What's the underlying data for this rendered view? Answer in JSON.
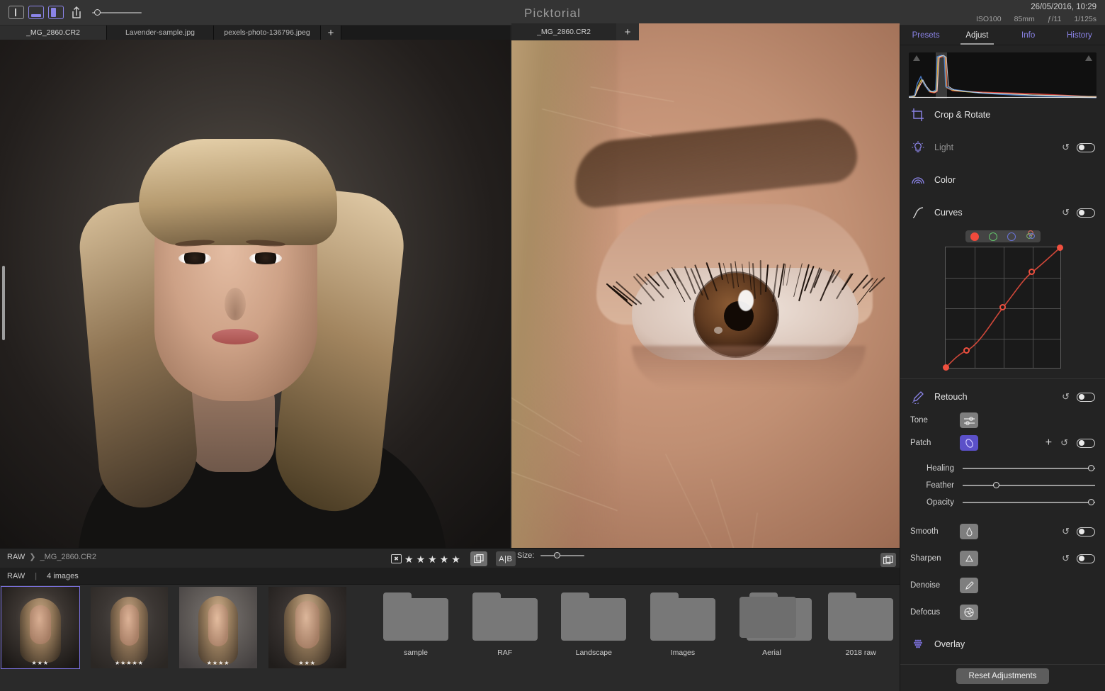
{
  "app": {
    "title": "Picktorial"
  },
  "topbar": {
    "view_modes": [
      {
        "name": "single-view",
        "selected": false
      },
      {
        "name": "split-horizontal-view",
        "selected": true
      },
      {
        "name": "split-vertical-view",
        "selected": true
      }
    ],
    "share_icon": "share-icon",
    "zoom_value": 12,
    "metadata": {
      "datetime": "26/05/2016, 10:29",
      "iso": "ISO100",
      "focal": "85mm",
      "aperture": "ƒ/11",
      "shutter": "1/125s"
    }
  },
  "tabs": {
    "items": [
      {
        "label": "_MG_2860.CR2",
        "active": true
      },
      {
        "label": "Lavender-sample.jpg",
        "active": false
      },
      {
        "label": "pexels-photo-136796.jpeg",
        "active": false
      }
    ],
    "add_label": "+"
  },
  "right_pane": {
    "tab_label": "_MG_2860.CR2",
    "add_label": "+",
    "size_label": "Size:",
    "size_value": 35,
    "fit_icon": "fit-to-screen-icon"
  },
  "bottom_toolbar": {
    "breadcrumb_root": "RAW",
    "breadcrumb_sep": "❯",
    "breadcrumb_file": "_MG_2860.CR2",
    "flag_icon": "reject-flag-icon",
    "stars": 5,
    "star_glyph": "★",
    "compare_icon": "compare-icon",
    "ab_label": "A|B"
  },
  "filmstrip": {
    "header": {
      "source": "RAW",
      "divider": "|",
      "count": "4 images"
    },
    "thumbs": [
      {
        "name": "thumb-1",
        "rating": 3,
        "selected": true
      },
      {
        "name": "thumb-2",
        "rating": 5,
        "selected": false
      },
      {
        "name": "thumb-3",
        "rating": 4,
        "selected": false
      },
      {
        "name": "thumb-4",
        "rating": 3,
        "selected": false
      }
    ],
    "folders": [
      {
        "label": "sample",
        "stacked": false
      },
      {
        "label": "RAF",
        "stacked": false
      },
      {
        "label": "Landscape",
        "stacked": false
      },
      {
        "label": "Images",
        "stacked": false
      },
      {
        "label": "Aerial",
        "stacked": true
      },
      {
        "label": "2018 raw",
        "stacked": false
      }
    ]
  },
  "panel": {
    "tabs": [
      {
        "label": "Presets",
        "active": false
      },
      {
        "label": "Adjust",
        "active": true
      },
      {
        "label": "Info",
        "active": false
      },
      {
        "label": "History",
        "active": false
      }
    ],
    "sections": {
      "crop": {
        "label": "Crop & Rotate",
        "icon": "crop-rotate-icon"
      },
      "light": {
        "label": "Light",
        "icon": "light-bulb-icon",
        "dim": true,
        "reset": "↺",
        "enabled": true
      },
      "color": {
        "label": "Color",
        "icon": "color-rainbow-icon"
      },
      "curves": {
        "label": "Curves",
        "icon": "curves-icon",
        "reset": "↺",
        "enabled": true
      },
      "retouch": {
        "label": "Retouch",
        "icon": "retouch-brush-icon",
        "reset": "↺",
        "enabled": true
      },
      "overlay": {
        "label": "Overlay",
        "icon": "overlay-grid-icon"
      }
    },
    "curves": {
      "channels": [
        {
          "name": "red-channel",
          "selected": true
        },
        {
          "name": "green-channel",
          "selected": false
        },
        {
          "name": "blue-channel",
          "selected": false
        },
        {
          "name": "rgb-channel",
          "selected": false
        }
      ],
      "points": [
        [
          0,
          0
        ],
        [
          18,
          14
        ],
        [
          50,
          50
        ],
        [
          75,
          79
        ],
        [
          100,
          100
        ]
      ],
      "curve_color": "#f0503f"
    },
    "retouch": {
      "tone_label": "Tone",
      "tone_icon": "tone-sliders-icon",
      "patch_label": "Patch",
      "patch_icon": "patch-icon",
      "patch_active": true,
      "add_label": "+",
      "reset": "↺",
      "sliders": [
        {
          "label": "Healing",
          "value": 100
        },
        {
          "label": "Feather",
          "value": 23
        },
        {
          "label": "Opacity",
          "value": 100
        }
      ]
    },
    "tools": [
      {
        "label": "Smooth",
        "icon": "smooth-drop-icon",
        "has_reset": true
      },
      {
        "label": "Sharpen",
        "icon": "sharpen-triangle-icon",
        "has_reset": true
      },
      {
        "label": "Denoise",
        "icon": "denoise-brush-icon",
        "has_reset": false
      },
      {
        "label": "Defocus",
        "icon": "defocus-aperture-icon",
        "has_reset": false
      }
    ],
    "reset_button": "Reset Adjustments"
  }
}
